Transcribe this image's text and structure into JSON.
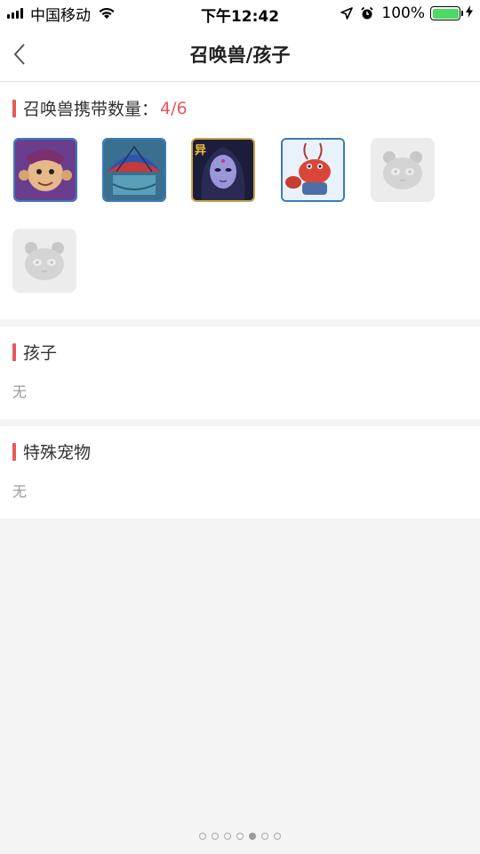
{
  "status_bar": {
    "carrier": "中国移动",
    "time": "下午12:42",
    "battery_percent": "100%",
    "battery_level": 1.0,
    "icons": [
      "signal-icon",
      "wifi-icon",
      "location-arrow-icon",
      "alarm-icon",
      "battery-icon",
      "charging-icon"
    ]
  },
  "nav": {
    "title": "召唤兽/孩子",
    "back_icon": "chevron-left-icon"
  },
  "pets_section": {
    "title": "召唤兽携带数量：",
    "count": "4/6",
    "slots": [
      {
        "type": "avatar",
        "label": "pet-1"
      },
      {
        "type": "avatar",
        "label": "pet-2"
      },
      {
        "type": "avatar",
        "label": "pet-3",
        "badge": "异"
      },
      {
        "type": "avatar",
        "label": "pet-4"
      },
      {
        "type": "empty"
      },
      {
        "type": "empty"
      }
    ]
  },
  "kids_section": {
    "title": "孩子",
    "empty_text": "无"
  },
  "special_section": {
    "title": "特殊宠物",
    "empty_text": "无"
  },
  "pager": {
    "total": 7,
    "active_index": 4
  },
  "colors": {
    "accent": "#e8575a",
    "background": "#f4f4f4",
    "battery": "#4cd964"
  }
}
